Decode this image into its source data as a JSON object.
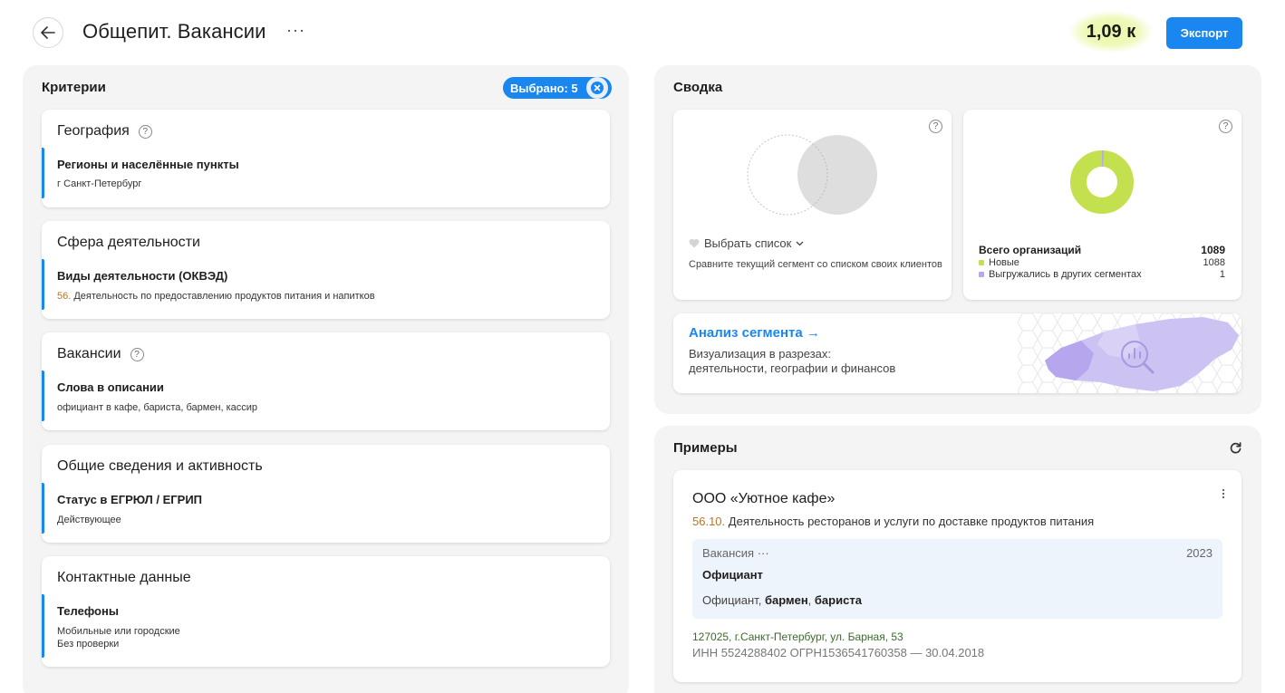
{
  "header": {
    "title": "Общепит. Вакансии",
    "more": "···",
    "count": "1,09 к",
    "export_label": "Экспорт"
  },
  "criteria": {
    "title": "Критерии",
    "selected": "Выбрано: 5",
    "cards": [
      {
        "title": "География",
        "has_help": true,
        "field": "Регионы и населённые пункты",
        "value": "г Санкт-Петербург"
      },
      {
        "title": "Сфера деятельности",
        "has_help": false,
        "field": "Виды деятельности (ОКВЭД)",
        "code": "56.",
        "value": "Деятельность по предоставлению продуктов питания и напитков"
      },
      {
        "title": "Вакансии",
        "has_help": true,
        "field": "Слова в описании",
        "value": "официант в кафе, бариста, бармен, кассир"
      },
      {
        "title": "Общие сведения и активность",
        "has_help": false,
        "field": "Статус в ЕГРЮЛ / ЕГРИП",
        "value": "Действующее"
      },
      {
        "title": "Контактные данные",
        "has_help": false,
        "field": "Телефоны",
        "value": "Мобильные или городские",
        "value2": "Без проверки"
      }
    ]
  },
  "summary": {
    "title": "Сводка",
    "compare": {
      "choose_label": "Выбрать список",
      "description": "Сравните текущий сегмент со списком своих клиентов"
    },
    "orgs": {
      "total_label": "Всего организаций",
      "total": "1089",
      "new_label": "Новые",
      "new": "1088",
      "exported_label": "Выгружались в других сегментах",
      "exported": "1",
      "colors": {
        "new": "#c3e14f",
        "exported": "#b9a7ee"
      }
    },
    "analysis": {
      "title": "Анализ сегмента →",
      "line1": "Визуализация в разрезах:",
      "line2": "деятельности, географии и финансов"
    }
  },
  "examples": {
    "title": "Примеры",
    "company": {
      "name": "ООО «Уютное кафе»",
      "okved_code": "56.10.",
      "okved_text": "Деятельность ресторанов и услуги по доставке продуктов питания",
      "vacancy_label": "Вакансия",
      "vacancy_more": "···",
      "vacancy_year": "2023",
      "vacancy_title": "Официант",
      "vacancy_words_plain": "Официант, ",
      "vacancy_words_bold1": "бармен",
      "vacancy_words_sep": ", ",
      "vacancy_words_bold2": "бариста",
      "address": "127025, г.Санкт-Петербург,  ул. Барная, 53",
      "reg": "ИНН 5524288402    ОГРН1536541760358 — 30.04.2018"
    }
  },
  "colors": {
    "accent": "#1a86f0"
  }
}
